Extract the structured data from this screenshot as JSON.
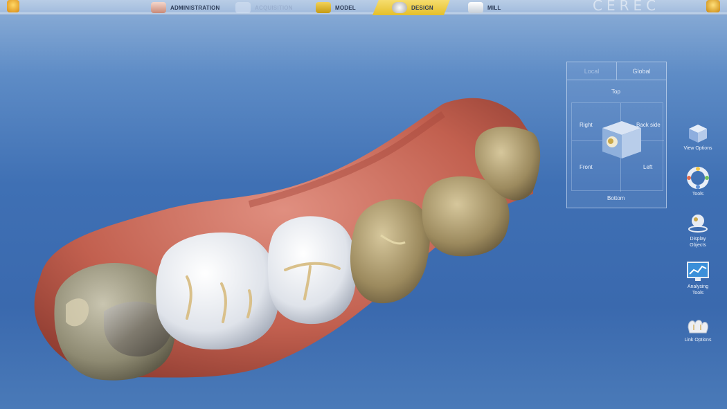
{
  "toolbar": {
    "steps": [
      {
        "label": "ADMINISTRATION",
        "state": "done"
      },
      {
        "label": "ACQUISITION",
        "state": "dim"
      },
      {
        "label": "MODEL",
        "state": "done"
      },
      {
        "label": "DESIGN",
        "state": "active"
      },
      {
        "label": "MILL",
        "state": "done"
      }
    ],
    "brand": "CEREC"
  },
  "view_panel": {
    "tabs": [
      "Local",
      "Global"
    ],
    "selected_tab": "Global",
    "labels": {
      "top": "Top",
      "right": "Right",
      "back_side": "Back side",
      "front": "Front",
      "left": "Left",
      "bottom": "Bottom"
    }
  },
  "tools": [
    {
      "label": "View Options",
      "icon": "view-cube-icon"
    },
    {
      "label": "Tools",
      "icon": "tools-ring-icon"
    },
    {
      "label": "Display Objects",
      "icon": "display-objects-icon"
    },
    {
      "label": "Analysing Tools",
      "icon": "analysing-tools-icon"
    },
    {
      "label": "Link Options",
      "icon": "link-options-icon"
    }
  ],
  "colors": {
    "background_top": "#8fb0d8",
    "background_mid": "#3f70b4",
    "active_step": "#e5bf2a",
    "gum": "#c8685a",
    "restoration": "#eceef2",
    "natural_tooth": "#b8a27a"
  }
}
